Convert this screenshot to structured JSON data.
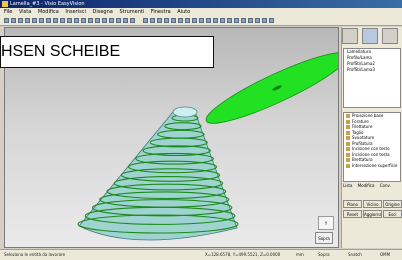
{
  "window": {
    "title": "Lamella_#3 - Visio EasyVision"
  },
  "menu": [
    "File",
    "Vista",
    "Modifica",
    "Inserisci",
    "Disegna",
    "Strumenti",
    "Finestra",
    "Aiuto"
  ],
  "annotation": {
    "text": "HSEN SCHEIBE"
  },
  "right_panel": {
    "tree_title": "Lamellatura",
    "tree_items": [
      "Profilo/Lama",
      "ProfSti/Lama2",
      "ProfSti/Lama3"
    ],
    "tool_items": [
      "Proiezione base",
      "Forature",
      "Filettature",
      "Taglio",
      "Svuotature",
      "Profilatura",
      "Incisione con testo",
      "Incisione con testa",
      "Brettatura",
      "Intersezione superficie"
    ],
    "tabs": [
      "Lista",
      "Modifica",
      "Conv."
    ],
    "buttons": [
      "Piano",
      "Vicino",
      "Origine",
      "Reset",
      "Aggiorna",
      "Esci"
    ]
  },
  "viewport": {
    "corner_label": "Y",
    "nav_label": "Sopra"
  },
  "status": {
    "hint": "Seleziona le entità da lavorare",
    "coords": "X=128.6578, Y=499.5521, Z=0.0000",
    "unit": "mm",
    "snap": "Sopra",
    "mode": "Snatch",
    "extra": "OMM"
  },
  "colors": {
    "cone_fill": "#9fd3d0",
    "disc_fill": "#22e022",
    "ring_line": "#1a8a1a"
  }
}
